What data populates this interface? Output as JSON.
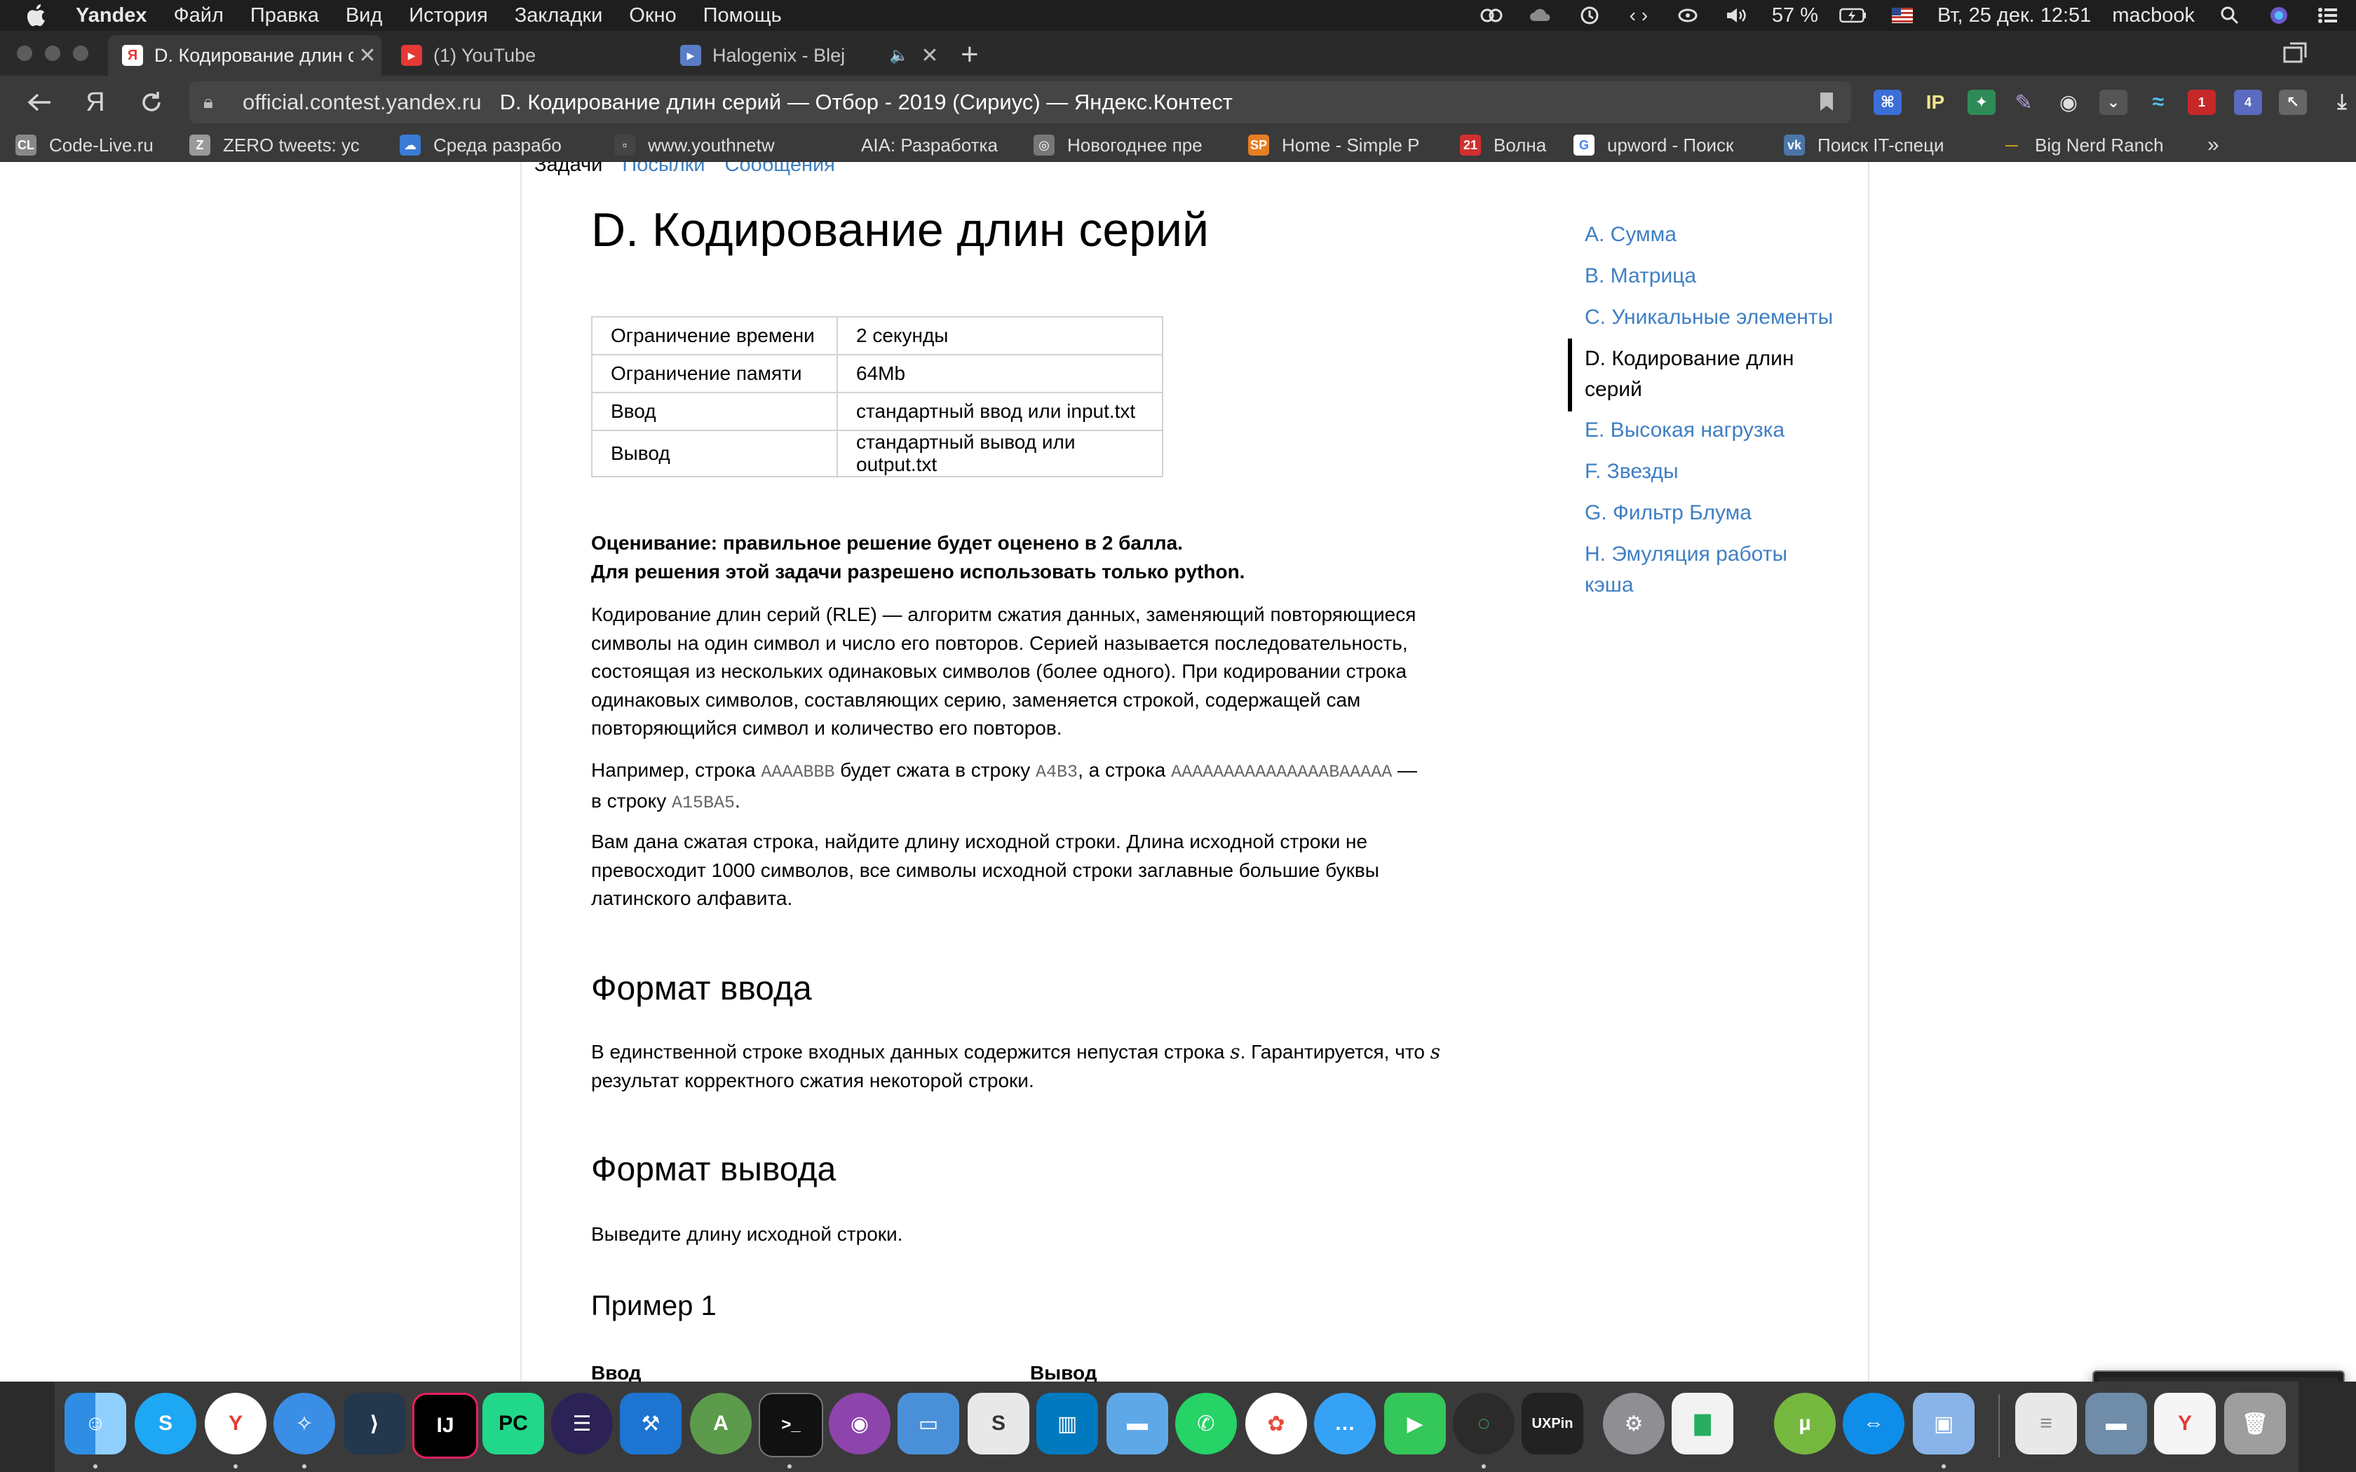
{
  "menubar": {
    "app_name": "Yandex",
    "items": [
      "Файл",
      "Правка",
      "Вид",
      "История",
      "Закладки",
      "Окно",
      "Помощь"
    ],
    "battery": "57 %",
    "datetime": "Вт, 25 дек.  12:51",
    "user": "macbook"
  },
  "tabs": [
    {
      "title": "D. Кодирование длин с",
      "favicon": "yandex-favicon",
      "active": true
    },
    {
      "title": "(1) YouTube",
      "favicon": "youtube-favicon",
      "active": false
    },
    {
      "title": "Halogenix - Blej",
      "favicon": "music-favicon",
      "active": false
    }
  ],
  "address": {
    "domain": "official.contest.yandex.ru",
    "page_title": "D. Кодирование длин серий — Отбор - 2019 (Сириус) — Яндекс.Контест"
  },
  "extensions": [
    "IP"
  ],
  "bookmarks": [
    "Code-Live.ru",
    "ZERO tweets: ус",
    "Среда разрабо",
    "www.youthnetw",
    "AIA: Разработка",
    "Новогоднее пре",
    "Home - Simple P",
    "Волна",
    "upword - Поиск",
    "Поиск IT-специ",
    "Big Nerd Ranch"
  ],
  "crumbs": {
    "first": "Задачи",
    "second": "Посылки",
    "third": "Сообщения"
  },
  "problem": {
    "title": "D. Кодирование длин серий",
    "limits": [
      {
        "key": "Ограничение времени",
        "value": "2 секунды"
      },
      {
        "key": "Ограничение памяти",
        "value": "64Mb"
      },
      {
        "key": "Ввод",
        "value": "стандартный ввод или input.txt"
      },
      {
        "key": "Вывод",
        "value": "стандартный вывод или output.txt"
      }
    ],
    "scoring_line1": "Оценивание: правильное решение будет оценено в 2 балла.",
    "scoring_line2": "Для решения этой задачи разрешено использовать только python.",
    "intro": "Кодирование длин серий (RLE) — алгоритм сжатия данных, заменяющий повторяющиеся символы на один символ и число его повторов. Серией называется последовательность, состоящая из нескольких одинаковых символов (более одного). При кодировании строка одинаковых символов, составляющих серию, заменяется строкой, содержащей сам повторяющийся символ и количество его повторов.",
    "example_text": {
      "p1": "Например, строка",
      "code1": "AAAABBB",
      "p2": "будет сжата в строку",
      "code2": "A4B3",
      "p3": ", а строка",
      "code3": "AAAAAAAAAAAAAAABAAAAA",
      "p4": "—",
      "p5": "в строку",
      "code4": "A15BA5",
      "p6": "."
    },
    "task": "Вам дана сжатая строка, найдите длину исходной строки. Длина исходной строки не превосходит 1000 символов, все символы исходной строки заглавные большие буквы латинского алфавита.",
    "input_heading": "Формат ввода",
    "input_text_1": "В единственной строке входных данных содержится непустая строка",
    "input_var": "s",
    "input_text_2": ". Гарантируется, что",
    "input_text_3": "результат корректного сжатия некоторой строки.",
    "output_heading": "Формат вывода",
    "output_text": "Выведите длину исходной строки.",
    "example_heading": "Пример 1",
    "example_in": "Ввод",
    "example_out": "Вывод"
  },
  "problem_nav": [
    {
      "label": "A. Сумма",
      "current": false
    },
    {
      "label": "B. Матрица",
      "current": false
    },
    {
      "label": "C. Уникальные элементы",
      "current": false
    },
    {
      "label": "D. Кодирование длин серий",
      "current": true
    },
    {
      "label": "E. Высокая нагрузка",
      "current": false
    },
    {
      "label": "F. Звезды",
      "current": false
    },
    {
      "label": "G. Фильтр Блума",
      "current": false
    },
    {
      "label": "H. Эмуляция работы кэша",
      "current": false
    }
  ],
  "dock": {
    "apps": [
      "finder",
      "skype",
      "yandex-browser",
      "safari",
      "vscode",
      "intellij-idea",
      "pycharm",
      "eclipse",
      "xcode",
      "android-studio",
      "terminal",
      "github-desktop",
      "keynote",
      "scrivener",
      "trello",
      "folder",
      "whatsapp",
      "photos",
      "messages",
      "facetime",
      "spinner-app",
      "UXPin",
      "system-preferences",
      "numbers",
      "utorrent",
      "teamviewer",
      "preview",
      "document",
      "folder-stack",
      "screenshot-stack",
      "trash"
    ]
  },
  "colors": {
    "link": "#3f7fc4",
    "menubar": "#1e1e1e",
    "toolbar": "#3a3a3a"
  }
}
